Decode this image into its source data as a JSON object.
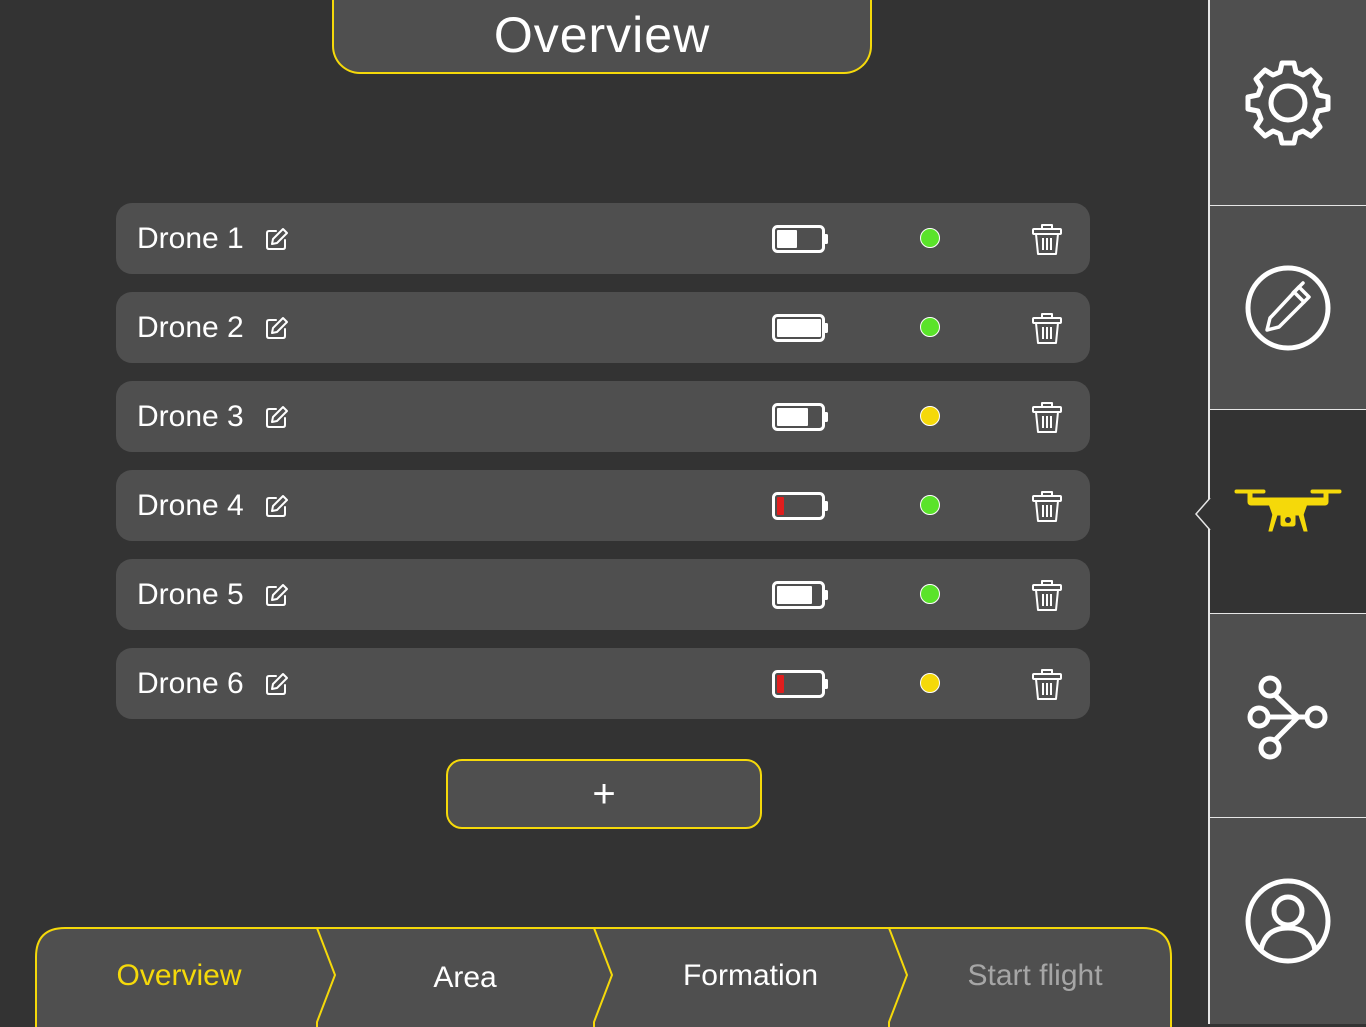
{
  "header": {
    "title": "Overview"
  },
  "drones": [
    {
      "name": "Drone 1",
      "battery_level": 0.45,
      "status_color": "#5ae32a"
    },
    {
      "name": "Drone 2",
      "battery_level": 1.0,
      "status_color": "#5ae32a"
    },
    {
      "name": "Drone 3",
      "battery_level": 0.7,
      "status_color": "#f5d90a"
    },
    {
      "name": "Drone 4",
      "battery_level": 0.15,
      "status_color": "#5ae32a"
    },
    {
      "name": "Drone 5",
      "battery_level": 0.8,
      "status_color": "#5ae32a"
    },
    {
      "name": "Drone 6",
      "battery_level": 0.15,
      "status_color": "#f5d90a"
    }
  ],
  "add_button": {
    "label": "+"
  },
  "steps": [
    {
      "label": "Overview",
      "state": "active"
    },
    {
      "label": "Area",
      "state": "normal"
    },
    {
      "label": "Formation",
      "state": "normal"
    },
    {
      "label": "Start flight",
      "state": "disabled"
    }
  ],
  "sidebar": {
    "items": [
      {
        "icon": "gear-icon"
      },
      {
        "icon": "pen-icon"
      },
      {
        "icon": "drone-icon",
        "active": true
      },
      {
        "icon": "share-icon"
      },
      {
        "icon": "user-icon"
      }
    ]
  },
  "colors": {
    "accent": "#f5d90a",
    "background": "#333333",
    "panel": "#4f4f4f",
    "battery_low": "#e01e1e",
    "status_ok": "#5ae32a",
    "status_warning": "#f5d90a",
    "text_disabled": "#a6a6a6"
  }
}
